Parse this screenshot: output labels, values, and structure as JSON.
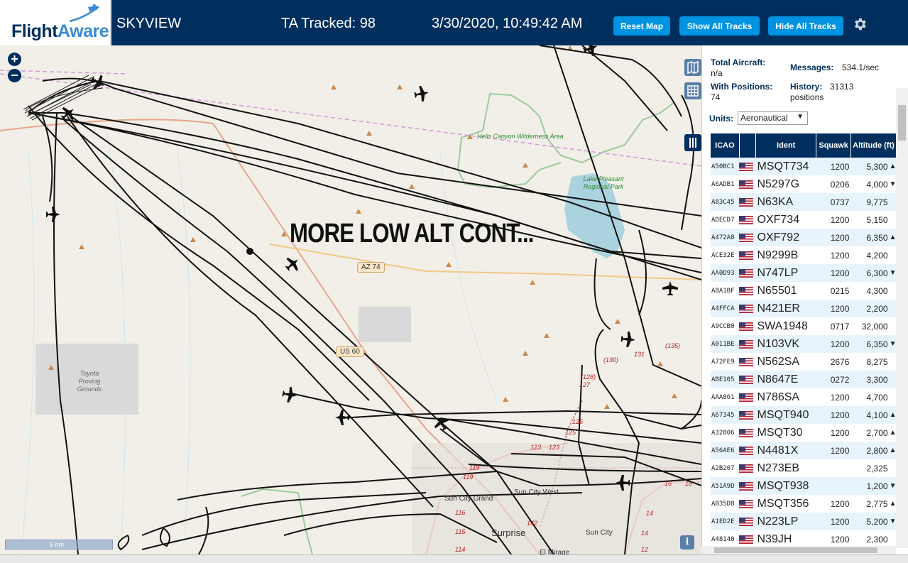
{
  "header": {
    "logo_text_a": "Flight",
    "logo_text_b": "Aware",
    "title": "SKYVIEW",
    "tracked": "TA Tracked: 98",
    "datetime": "3/30/2020, 10:49:42 AM",
    "reset_label": "Reset Map",
    "show_label": "Show All Tracks",
    "hide_label": "Hide All Tracks",
    "settings_icon": "gear-icon"
  },
  "map": {
    "overlay_text": "MORE LOW ALT CONT...",
    "zoom_in": "+",
    "zoom_out": "−",
    "scale": "5 nm",
    "info": "i",
    "labels": {
      "hells_canyon": "Hells Canyon Wilderness Area",
      "lake_pleasant": "Lake Pleasant Regional Park",
      "toyota": "Toyota Proving Grounds",
      "az74": "AZ 74",
      "us60": "US 60",
      "sun_city_grand": "Sun City Grand",
      "sun_city_west": "Sun City West",
      "surprise": "Surprise",
      "sun_city": "Sun City",
      "el_mirage": "El Mirage",
      "r128": "(128)",
      "r130": "(130)",
      "r135": "(135)",
      "r131": "131",
      "r127": "127",
      "r125a": "125",
      "r125b": "125",
      "r123a": "123",
      "r123b": "123",
      "r119a": "119",
      "r119b": "119",
      "r116": "116",
      "r115": "115",
      "r114": "114",
      "r142": "142",
      "r14a": "14",
      "r14b": "14",
      "r12": "12",
      "r18": "18",
      "r16": "16"
    }
  },
  "stats": {
    "total_label": "Total Aircraft:",
    "total_value": "n/a",
    "positions_label": "With Positions:",
    "positions_value": "74",
    "messages_label": "Messages:",
    "messages_value": "534.1/sec",
    "history_label": "History:",
    "history_value": "31313",
    "history_unit": "positions",
    "units_label": "Units:",
    "units_value": "Aeronautical"
  },
  "table": {
    "columns": [
      "ICAO",
      "Ident",
      "Squawk",
      "Altitude (ft)"
    ],
    "rows": [
      {
        "icao": "A50BC1",
        "ident": "MSQT734",
        "squawk": "1200",
        "alt": "5,300",
        "arrow": "▲"
      },
      {
        "icao": "A6ADB1",
        "ident": "N5297G",
        "squawk": "0206",
        "alt": "4,000",
        "arrow": "▼"
      },
      {
        "icao": "A83C45",
        "ident": "N63KA",
        "squawk": "0737",
        "alt": "9,775",
        "arrow": ""
      },
      {
        "icao": "ADECD7",
        "ident": "OXF734",
        "squawk": "1200",
        "alt": "5,150",
        "arrow": ""
      },
      {
        "icao": "A472A8",
        "ident": "OXF792",
        "squawk": "1200",
        "alt": "6,350",
        "arrow": "▲"
      },
      {
        "icao": "ACE32E",
        "ident": "N9299B",
        "squawk": "1200",
        "alt": "4,200",
        "arrow": ""
      },
      {
        "icao": "AA0D93",
        "ident": "N747LP",
        "squawk": "1200",
        "alt": "6,300",
        "arrow": "▼"
      },
      {
        "icao": "A8A1BF",
        "ident": "N65501",
        "squawk": "0215",
        "alt": "4,300",
        "arrow": ""
      },
      {
        "icao": "A4FFCA",
        "ident": "N421ER",
        "squawk": "1200",
        "alt": "2,200",
        "arrow": ""
      },
      {
        "icao": "A9CCB0",
        "ident": "SWA1948",
        "squawk": "0717",
        "alt": "32,000",
        "arrow": ""
      },
      {
        "icao": "A011BE",
        "ident": "N103VK",
        "squawk": "1200",
        "alt": "6,350",
        "arrow": "▼"
      },
      {
        "icao": "A72FE9",
        "ident": "N562SA",
        "squawk": "2676",
        "alt": "8,275",
        "arrow": ""
      },
      {
        "icao": "ABE105",
        "ident": "N8647E",
        "squawk": "0272",
        "alt": "3,300",
        "arrow": ""
      },
      {
        "icao": "AAA861",
        "ident": "N786SA",
        "squawk": "1200",
        "alt": "4,700",
        "arrow": ""
      },
      {
        "icao": "A67345",
        "ident": "MSQT940",
        "squawk": "1200",
        "alt": "4,100",
        "arrow": "▲"
      },
      {
        "icao": "A32806",
        "ident": "MSQT30",
        "squawk": "1200",
        "alt": "2,700",
        "arrow": "▲"
      },
      {
        "icao": "A56AE6",
        "ident": "N4481X",
        "squawk": "1200",
        "alt": "2,800",
        "arrow": "▲"
      },
      {
        "icao": "A2B207",
        "ident": "N273EB",
        "squawk": "",
        "alt": "2,325",
        "arrow": ""
      },
      {
        "icao": "A51A9D",
        "ident": "MSQT938",
        "squawk": "",
        "alt": "1,200",
        "arrow": "▼"
      },
      {
        "icao": "AB35D8",
        "ident": "MSQT356",
        "squawk": "1200",
        "alt": "2,775",
        "arrow": "▲"
      },
      {
        "icao": "A1ED2E",
        "ident": "N223LP",
        "squawk": "1200",
        "alt": "5,200",
        "arrow": "▼"
      },
      {
        "icao": "A48140",
        "ident": "N39JH",
        "squawk": "1200",
        "alt": "2,300",
        "arrow": ""
      }
    ]
  },
  "colors": {
    "header_bg": "#002f5d",
    "button_bg": "#0093e2",
    "row_alt": "#e8f4fc",
    "map_bg": "#f1efe8"
  }
}
